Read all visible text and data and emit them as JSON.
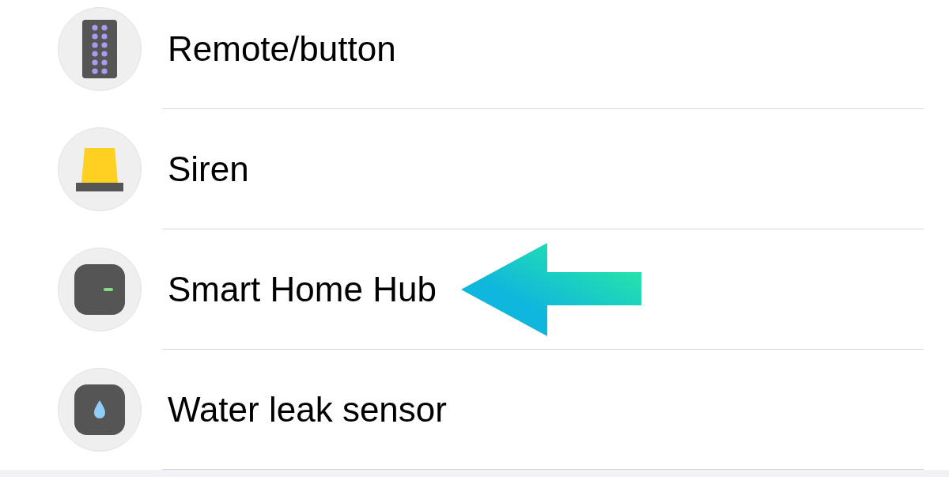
{
  "rows": [
    {
      "kind": "remote",
      "label": "Remote/button",
      "highlighted": false
    },
    {
      "kind": "siren",
      "label": "Siren",
      "highlighted": false
    },
    {
      "kind": "hub",
      "label": "Smart Home Hub",
      "highlighted": true
    },
    {
      "kind": "leak",
      "label": "Water leak sensor",
      "highlighted": false
    }
  ]
}
